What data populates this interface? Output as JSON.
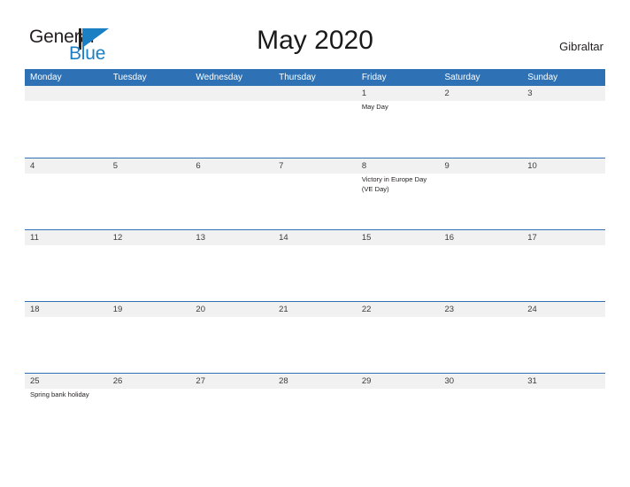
{
  "brand": {
    "name_part1": "General",
    "name_part2": "Blue",
    "logo_icon": "flag-triangle-icon"
  },
  "header": {
    "title": "May 2020",
    "country": "Gibraltar"
  },
  "calendar": {
    "month": "May",
    "year": "2020",
    "weekday_headers": [
      "Monday",
      "Tuesday",
      "Wednesday",
      "Thursday",
      "Friday",
      "Saturday",
      "Sunday"
    ],
    "weeks": [
      [
        {
          "date": "",
          "events": []
        },
        {
          "date": "",
          "events": []
        },
        {
          "date": "",
          "events": []
        },
        {
          "date": "",
          "events": []
        },
        {
          "date": "1",
          "events": [
            "May Day"
          ]
        },
        {
          "date": "2",
          "events": []
        },
        {
          "date": "3",
          "events": []
        }
      ],
      [
        {
          "date": "4",
          "events": []
        },
        {
          "date": "5",
          "events": []
        },
        {
          "date": "6",
          "events": []
        },
        {
          "date": "7",
          "events": []
        },
        {
          "date": "8",
          "events": [
            "Victory in Europe Day (VE Day)"
          ]
        },
        {
          "date": "9",
          "events": []
        },
        {
          "date": "10",
          "events": []
        }
      ],
      [
        {
          "date": "11",
          "events": []
        },
        {
          "date": "12",
          "events": []
        },
        {
          "date": "13",
          "events": []
        },
        {
          "date": "14",
          "events": []
        },
        {
          "date": "15",
          "events": []
        },
        {
          "date": "16",
          "events": []
        },
        {
          "date": "17",
          "events": []
        }
      ],
      [
        {
          "date": "18",
          "events": []
        },
        {
          "date": "19",
          "events": []
        },
        {
          "date": "20",
          "events": []
        },
        {
          "date": "21",
          "events": []
        },
        {
          "date": "22",
          "events": []
        },
        {
          "date": "23",
          "events": []
        },
        {
          "date": "24",
          "events": []
        }
      ],
      [
        {
          "date": "25",
          "events": [
            "Spring bank holiday"
          ]
        },
        {
          "date": "26",
          "events": []
        },
        {
          "date": "27",
          "events": []
        },
        {
          "date": "28",
          "events": []
        },
        {
          "date": "29",
          "events": []
        },
        {
          "date": "30",
          "events": []
        },
        {
          "date": "31",
          "events": []
        }
      ]
    ]
  },
  "colors": {
    "header_blue": "#2e72b5",
    "brand_blue": "#1b7fc4",
    "band_gray": "#f1f1f1",
    "text_dark": "#231f20"
  }
}
